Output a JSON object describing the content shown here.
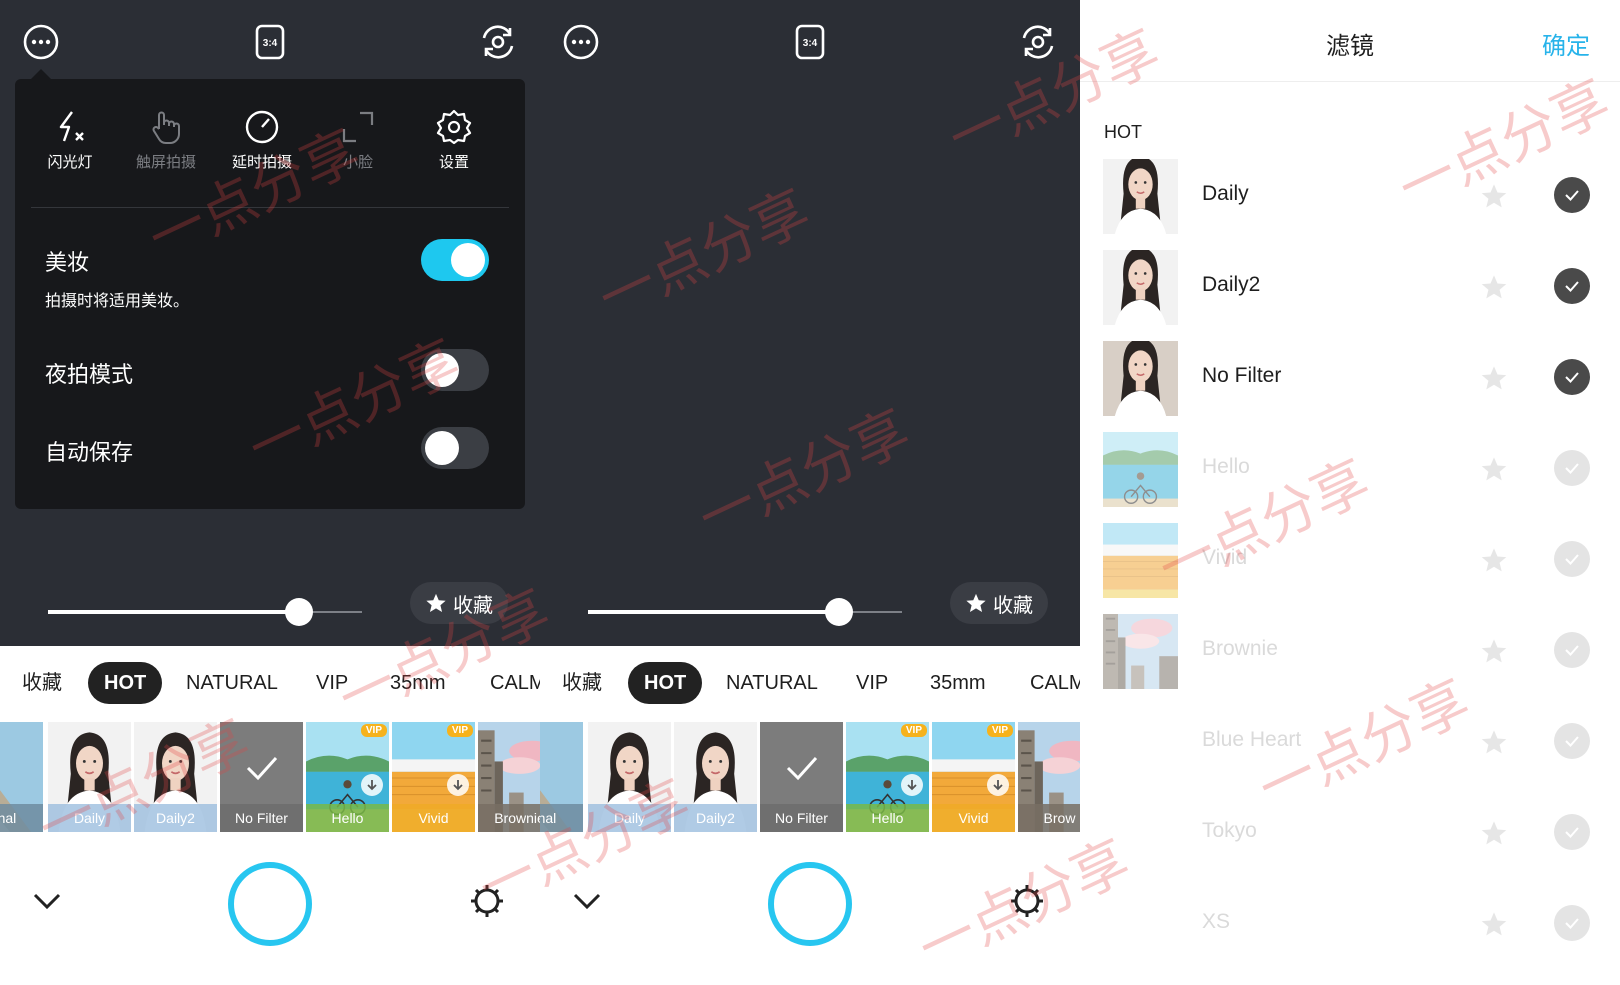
{
  "colors": {
    "accent": "#27c6f0",
    "toggle_on": "#1ec8ef",
    "confirm": "#27b3ea",
    "dark_bg": "#2b2e35",
    "menu_bg": "#17181b"
  },
  "camera": {
    "top": {
      "more_icon": "more-dots-icon",
      "ratio_label": "3:4",
      "flip_icon": "camera-flip-icon"
    },
    "quick_menu": [
      {
        "label": "闪光灯",
        "icon": "flash-off-icon",
        "enabled": true
      },
      {
        "label": "触屏拍摄",
        "icon": "touch-shoot-icon",
        "enabled": false
      },
      {
        "label": "延时拍摄",
        "icon": "timer-icon",
        "enabled": true
      },
      {
        "label": "小脸",
        "icon": "small-face-icon",
        "enabled": false
      },
      {
        "label": "设置",
        "icon": "settings-icon",
        "enabled": true
      }
    ],
    "settings": [
      {
        "title": "美妆",
        "subtitle": "拍摄时将适用美妆。",
        "on": true
      },
      {
        "title": "夜拍模式",
        "on": false
      },
      {
        "title": "自动保存",
        "on": false
      }
    ],
    "intensity_slider": 0.8,
    "favorite_label": "收藏",
    "tabs": [
      {
        "label": "收藏",
        "active": false
      },
      {
        "label": "HOT",
        "active": true
      },
      {
        "label": "NATURAL",
        "active": false
      },
      {
        "label": "VIP",
        "active": false
      },
      {
        "label": "35mm",
        "active": false
      },
      {
        "label": "CALM",
        "active": false
      }
    ],
    "filters": [
      {
        "label": "Original",
        "kind": "original"
      },
      {
        "label": "Daily",
        "kind": "portrait"
      },
      {
        "label": "Daily2",
        "kind": "portrait"
      },
      {
        "label": "No Filter",
        "kind": "selected"
      },
      {
        "label": "Hello",
        "kind": "lake",
        "vip": "VIP"
      },
      {
        "label": "Vivid",
        "kind": "wall",
        "vip": "VIP"
      },
      {
        "label": "Brownie",
        "kind": "city"
      }
    ],
    "filter_labels_shown_1": [
      "ginal",
      "Daily",
      "Daily2",
      "No Filter",
      "Hello",
      "Vivid",
      "Brownie"
    ],
    "filter_labels_shown_2": [
      "ginal",
      "Daily",
      "Daily2",
      "No Filter",
      "Hello",
      "Vivid",
      "Brow"
    ]
  },
  "filter_list": {
    "title": "滤镜",
    "confirm": "确定",
    "section": "HOT",
    "items": [
      {
        "name": "Daily",
        "checked": true,
        "thumb": "portrait"
      },
      {
        "name": "Daily2",
        "checked": true,
        "thumb": "portrait"
      },
      {
        "name": "No Filter",
        "checked": true,
        "thumb": "portrait-plain"
      },
      {
        "name": "Hello",
        "checked": false,
        "thumb": "lake"
      },
      {
        "name": "Vivid",
        "checked": false,
        "thumb": "wall"
      },
      {
        "name": "Brownie",
        "checked": false,
        "thumb": "city"
      },
      {
        "name": "Blue Heart",
        "checked": false,
        "thumb": ""
      },
      {
        "name": "Tokyo",
        "checked": false,
        "thumb": ""
      },
      {
        "name": "XS",
        "checked": false,
        "thumb": ""
      }
    ]
  },
  "watermark": "一点分享"
}
